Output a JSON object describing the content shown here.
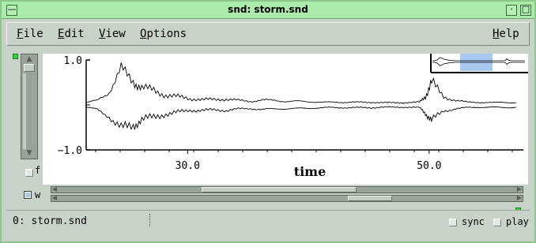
{
  "window": {
    "title": "snd: storm.snd"
  },
  "title_buttons": {
    "menu_glyph": "—",
    "minimize_glyph": "·",
    "maximize_glyph": "□"
  },
  "menu": {
    "file": {
      "accel": "F",
      "rest": "ile"
    },
    "edit": {
      "accel": "E",
      "rest": "dit"
    },
    "view": {
      "accel": "V",
      "rest": "iew"
    },
    "options": {
      "accel": "O",
      "rest": "ptions"
    },
    "help": {
      "accel": "H",
      "rest": "elp"
    }
  },
  "graph": {
    "y_top_label": "1.0",
    "y_bottom_label": "−1.0",
    "x_label": "time",
    "x_ticks": [
      "30.0",
      "50.0"
    ],
    "x_tick_values": [
      30.0,
      50.0
    ],
    "x_range": [
      21.6,
      57.8
    ],
    "y_range": [
      -1.0,
      1.0
    ]
  },
  "chart_data": {
    "type": "line",
    "title": "",
    "xlabel": "time",
    "ylabel": "",
    "xlim": [
      21.6,
      57.8
    ],
    "ylim": [
      -1.0,
      1.0
    ],
    "x_ticks": [
      "30.0",
      "50.0"
    ],
    "y_ticks": [
      "1.0",
      "-1.0"
    ],
    "series": [
      {
        "x": [
          21.6,
          22.5,
          23.5,
          24.5,
          25.5,
          26.2,
          27.2,
          28.2,
          29.2,
          30.2,
          31.2,
          32.2,
          33.2,
          34.2,
          35.2,
          36.2,
          37.2,
          38.2,
          39.2,
          40.2,
          41.2,
          42.2,
          43.2,
          44.2,
          45.2,
          46.2,
          47.2,
          48.2,
          49.2,
          49.7,
          50.2,
          51.2,
          52.2,
          53.2,
          54.2,
          55.2,
          56.2,
          57.2
        ],
        "values": [
          0.05,
          0.1,
          0.3,
          0.75,
          0.55,
          0.38,
          0.32,
          0.22,
          0.18,
          0.14,
          0.12,
          0.12,
          0.13,
          0.1,
          0.08,
          0.11,
          0.1,
          0.08,
          0.08,
          0.07,
          0.06,
          0.06,
          0.06,
          0.06,
          0.06,
          0.05,
          0.05,
          0.05,
          0.06,
          0.2,
          0.5,
          0.18,
          0.1,
          0.06,
          0.06,
          0.05,
          0.06,
          0.05
        ]
      },
      {
        "x": [
          21.6,
          22.5,
          23.5,
          24.5,
          25.5,
          26.2,
          27.2,
          28.2,
          29.2,
          30.2,
          31.2,
          32.2,
          33.2,
          34.2,
          35.2,
          36.2,
          37.2,
          38.2,
          39.2,
          40.2,
          41.2,
          42.2,
          43.2,
          44.2,
          45.2,
          46.2,
          47.2,
          48.2,
          49.2,
          49.7,
          50.2,
          51.2,
          52.2,
          53.2,
          54.2,
          55.2,
          56.2,
          57.2
        ],
        "values": [
          -0.05,
          -0.1,
          -0.25,
          -0.55,
          -0.45,
          -0.32,
          -0.28,
          -0.2,
          -0.16,
          -0.12,
          -0.12,
          -0.11,
          -0.12,
          -0.09,
          -0.08,
          -0.1,
          -0.09,
          -0.08,
          -0.08,
          -0.07,
          -0.06,
          -0.06,
          -0.06,
          -0.06,
          -0.06,
          -0.05,
          -0.05,
          -0.05,
          -0.06,
          -0.18,
          -0.35,
          -0.14,
          -0.08,
          -0.06,
          -0.05,
          -0.05,
          -0.06,
          -0.05
        ]
      }
    ]
  },
  "overview": {
    "highlight_color": "#a8c8f0"
  },
  "checkboxes": {
    "f_label": "f",
    "w_label": "w",
    "sync_label": "sync",
    "play_label": "play"
  },
  "scrollbars": {
    "zoom_position": 0.48,
    "position_position": 0.78
  },
  "status": {
    "text": "0: storm.snd"
  },
  "colors": {
    "titlebar": "#aaeaaa",
    "window": "#c8d2c8",
    "grip": "#2fd82f"
  }
}
